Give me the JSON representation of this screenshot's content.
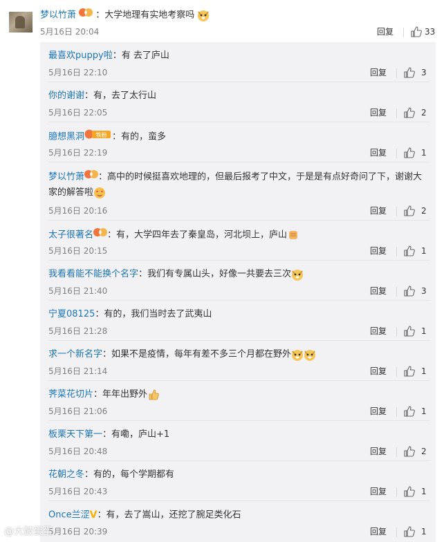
{
  "main_comment": {
    "username": "梦以竹萧",
    "text": "：大学地理有实地考察吗",
    "time": "5月16日 20:04",
    "reply_label": "回复",
    "likes": "33"
  },
  "replies": [
    {
      "username": "最喜欢puppy啦",
      "text": "：有 去了庐山",
      "time": "5月16日 22:10",
      "reply_label": "回复",
      "likes": "3",
      "badge": "none",
      "emoji": []
    },
    {
      "username": "你的谢谢",
      "text": "：有，去了太行山",
      "time": "5月16日 22:05",
      "reply_label": "回复",
      "likes": "2",
      "badge": "none",
      "emoji": []
    },
    {
      "username": "臆想黑洞",
      "text": "：有的，蛮多",
      "time": "5月16日 22:19",
      "reply_label": "回复",
      "likes": "1",
      "badge": "fan-badge",
      "badge_text": "铁粉",
      "emoji": []
    },
    {
      "username": "梦以竹萧",
      "text": "：高中的时候挺喜欢地理的，但最后报考了中文，于是是有点好奇问了下，谢谢大",
      "text2": "家的解答啦",
      "time": "5月16日 20:16",
      "reply_label": "回复",
      "likes": "2",
      "badge": "member-badge",
      "emoji": [
        "love-face"
      ]
    },
    {
      "username": "太子很著名",
      "text": "：有，大学四年去了秦皇岛，河北坝上，庐山",
      "time": "5月16日 20:15",
      "reply_label": "回复",
      "likes": "1",
      "badge": "member-badge",
      "emoji": [
        "fist"
      ]
    },
    {
      "username": "我看看能不能换个名字",
      "text": "：我们有专属山头，好像一共要去三次",
      "time": "5月16日 21:40",
      "reply_label": "回复",
      "likes": "3",
      "badge": "none",
      "emoji": [
        "doge"
      ]
    },
    {
      "username": "宁夏08125",
      "text": "：有的，我们当时去了武夷山",
      "time": "5月16日 21:28",
      "reply_label": "回复",
      "likes": "1",
      "badge": "none",
      "emoji": []
    },
    {
      "username": "求一个新名字",
      "text": "：如果不是疫情，每年有差不多三个月都在野外",
      "time": "5月16日 21:14",
      "reply_label": "回复",
      "likes": "1",
      "badge": "none",
      "emoji": [
        "doge",
        "doge"
      ]
    },
    {
      "username": "荠菜花切片",
      "text": "：年年出野外",
      "time": "5月16日 21:06",
      "reply_label": "回复",
      "likes": "1",
      "badge": "none",
      "emoji": [
        "thumbs-up"
      ]
    },
    {
      "username": "板栗天下第一",
      "text": "：有嘞，庐山+1",
      "time": "5月16日 20:48",
      "reply_label": "回复",
      "likes": "2",
      "badge": "none",
      "emoji": []
    },
    {
      "username": "花朝之冬",
      "text": "：有的，每个学期都有",
      "time": "5月16日 20:43",
      "reply_label": "回复",
      "likes": "1",
      "badge": "none",
      "emoji": []
    },
    {
      "username": "Once兰涩",
      "text": "：有，去了嵩山，还挖了腕足类化石",
      "time": "5月16日 20:39",
      "reply_label": "回复",
      "likes": "1",
      "badge": "verified-v",
      "emoji": []
    }
  ],
  "watermark": "@大鼓蛋蛋"
}
